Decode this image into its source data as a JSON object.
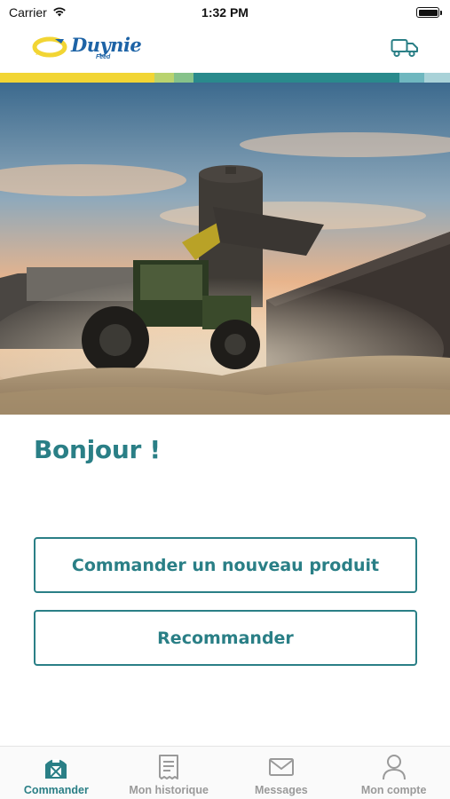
{
  "status_bar": {
    "carrier": "Carrier",
    "time": "1:32 PM",
    "battery_level": 1.0
  },
  "header": {
    "logo_text": "Duynie",
    "logo_subtext": "Feed",
    "truck_icon": "truck-icon"
  },
  "stripe_colors": [
    "#f2d534",
    "#b9d36f",
    "#86c28a",
    "#2a8a8c",
    "#6fb7bf",
    "#a9d2d8"
  ],
  "hero": {
    "image_description_icon": "hero-photo"
  },
  "greeting": "Bonjour !",
  "buttons": {
    "new_product": "Commander un nouveau produit",
    "reorder": "Recommander"
  },
  "tabs": [
    {
      "label": "Commander",
      "icon": "barn-icon",
      "active": true
    },
    {
      "label": "Mon historique",
      "icon": "receipt-icon",
      "active": false
    },
    {
      "label": "Messages",
      "icon": "envelope-icon",
      "active": false
    },
    {
      "label": "Mon compte",
      "icon": "person-icon",
      "active": false
    }
  ],
  "colors": {
    "accent": "#2a7f86",
    "inactive": "#9a9a9a",
    "brand_blue": "#1d63a6",
    "brand_yellow": "#f2d534"
  }
}
